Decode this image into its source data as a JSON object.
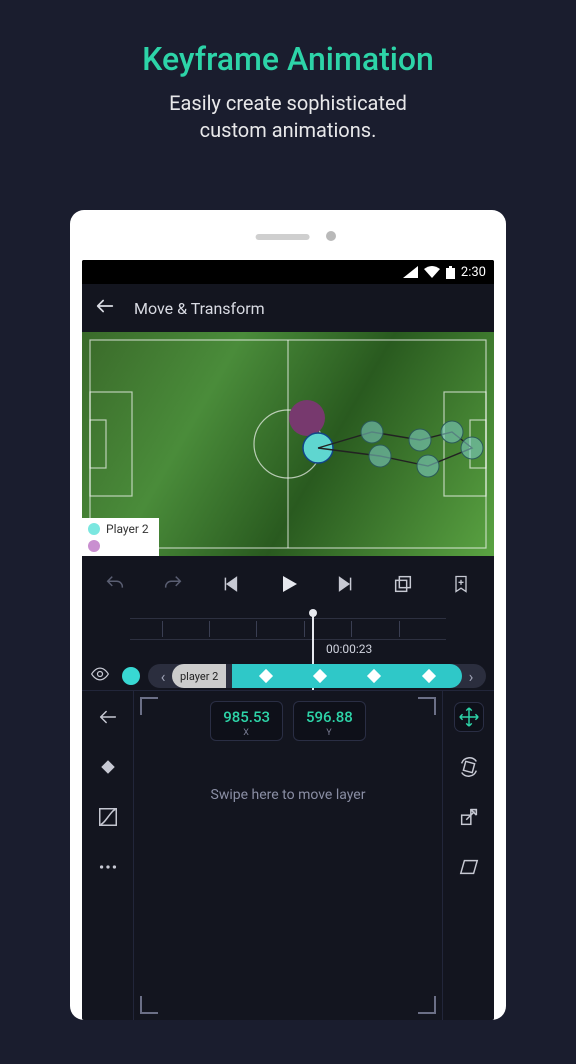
{
  "promo": {
    "title": "Keyframe Animation",
    "subtitle_l1": "Easily create sophisticated",
    "subtitle_l2": "custom animations."
  },
  "statusbar": {
    "time": "2:30"
  },
  "appbar": {
    "title": "Move & Transform"
  },
  "legend": {
    "player2_label": "Player 2",
    "player2_color": "#7be7e0",
    "player1_color": "#c98fd0"
  },
  "timeline": {
    "timecode": "00:00:23",
    "layer_name": "player 2"
  },
  "coords": {
    "x_value": "985.53",
    "x_label": "X",
    "y_value": "596.88",
    "y_label": "Y"
  },
  "hints": {
    "swipe": "Swipe here to move layer"
  },
  "colors": {
    "accent": "#2dd4a8",
    "keyframe_track": "#2fc8c8"
  }
}
